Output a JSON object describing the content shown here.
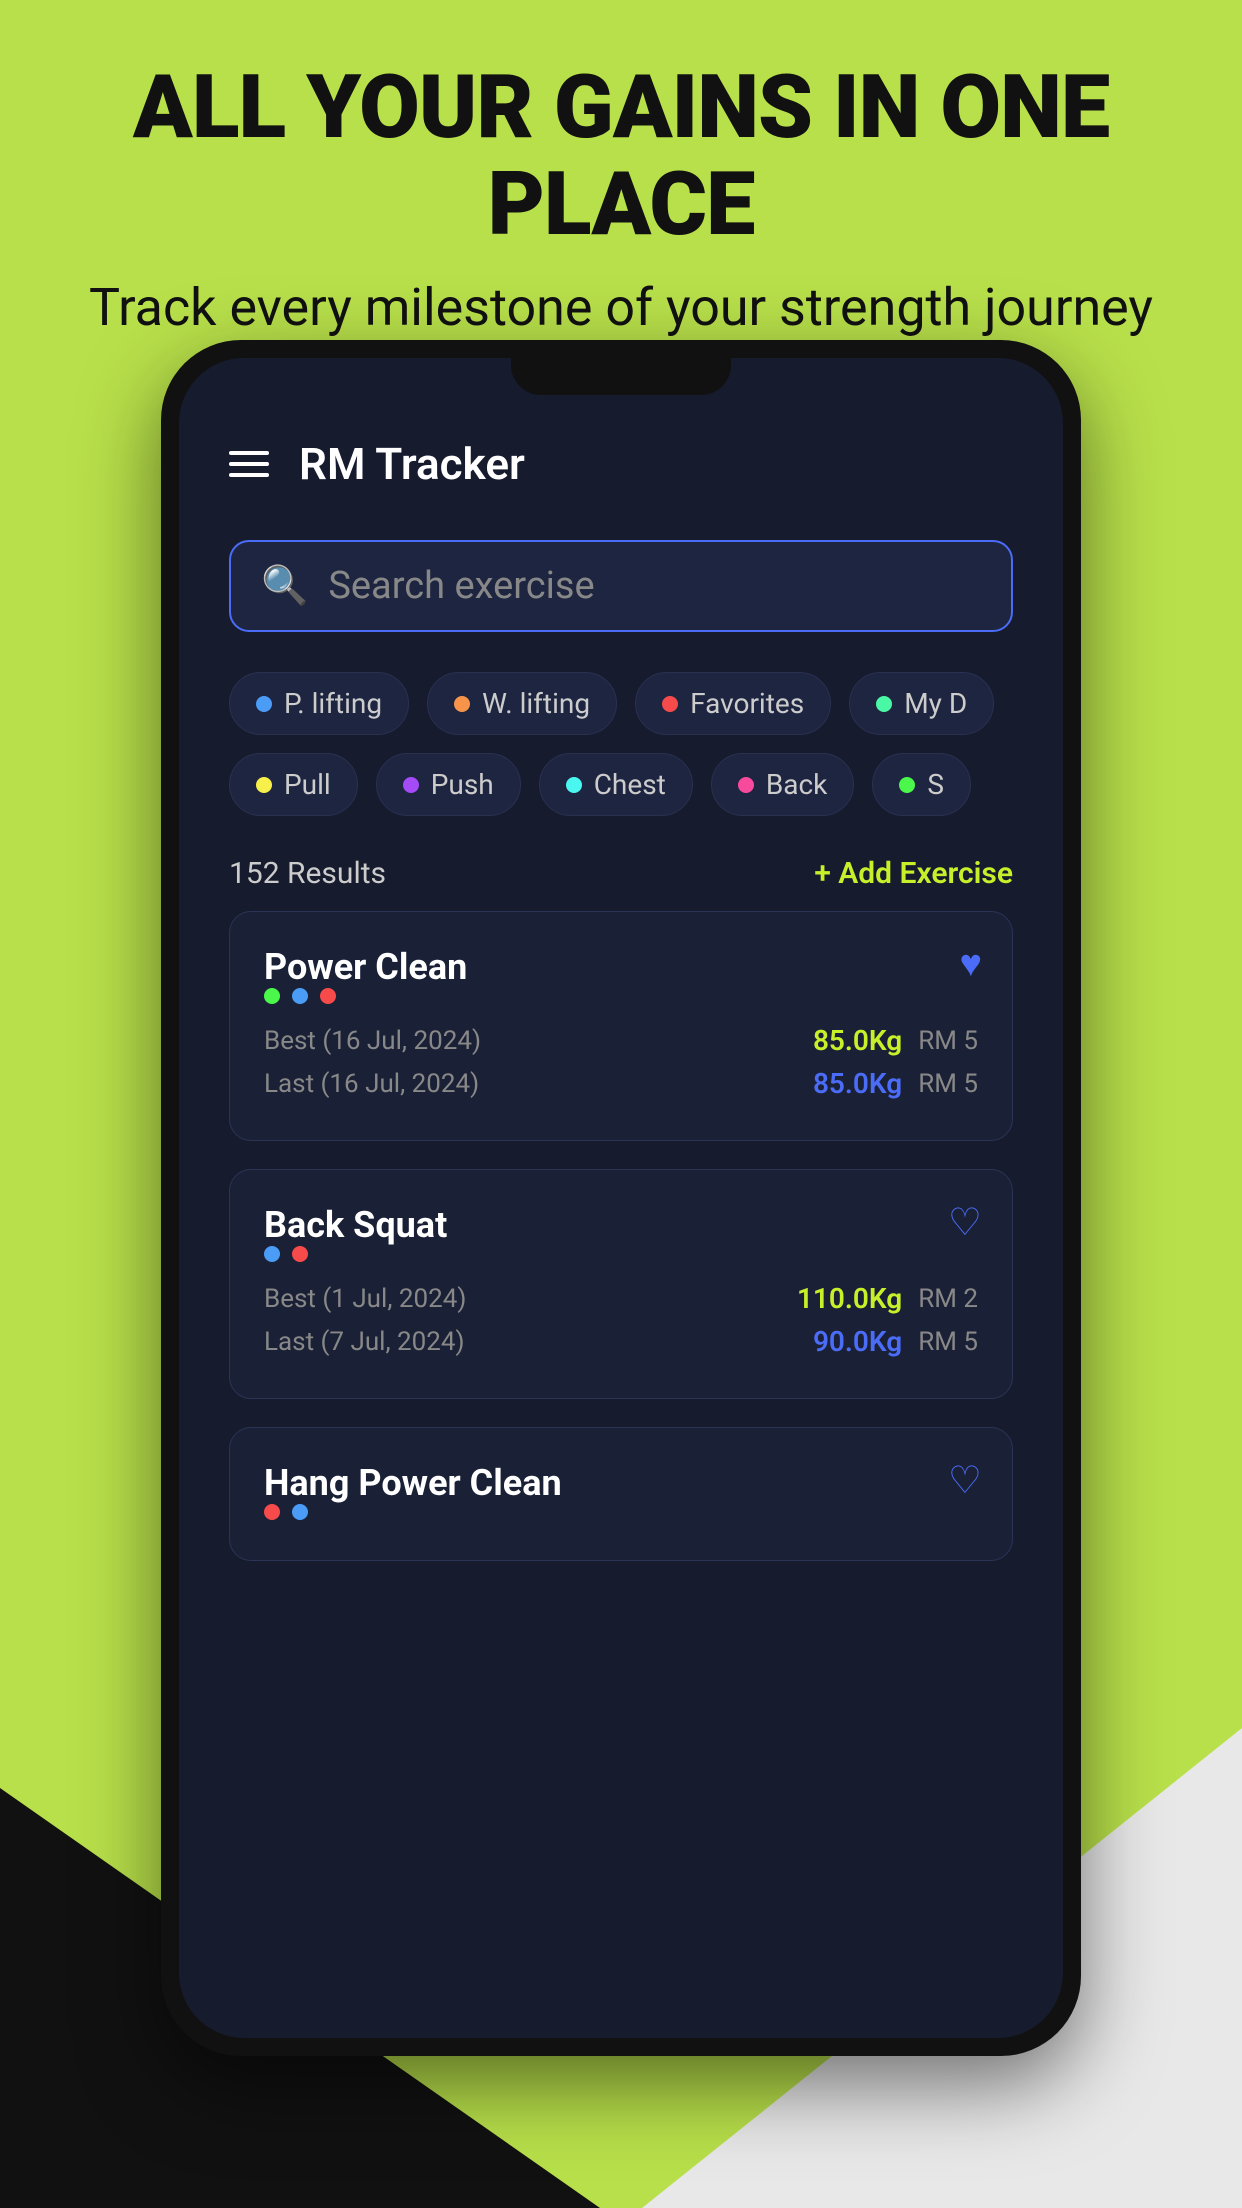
{
  "background": {
    "color": "#b8e04a"
  },
  "header": {
    "main_title": "ALL YOUR GAINS IN ONE PLACE",
    "subtitle": "Track every milestone of your strength journey"
  },
  "app": {
    "title": "RM Tracker"
  },
  "search": {
    "placeholder": "Search exercise"
  },
  "filter_row1": [
    {
      "id": "powerlifting",
      "label": "P. lifting",
      "dot_color": "#4a9cf7"
    },
    {
      "id": "weightlifting",
      "label": "W. lifting",
      "dot_color": "#f7944a"
    },
    {
      "id": "favorites",
      "label": "Favorites",
      "dot_color": "#f74a4a"
    },
    {
      "id": "my",
      "label": "My D",
      "dot_color": "#4af7a4"
    }
  ],
  "filter_row2": [
    {
      "id": "pull",
      "label": "Pull",
      "dot_color": "#f7f04a"
    },
    {
      "id": "push",
      "label": "Push",
      "dot_color": "#a44af7"
    },
    {
      "id": "chest",
      "label": "Chest",
      "dot_color": "#4af7f0"
    },
    {
      "id": "back",
      "label": "Back",
      "dot_color": "#f74a9c"
    },
    {
      "id": "more",
      "label": "S",
      "dot_color": "#4af74a"
    }
  ],
  "results": {
    "count": "152 Results",
    "add_label": "+ Add Exercise"
  },
  "exercises": [
    {
      "id": "power-clean",
      "name": "Power Clean",
      "dots": [
        "#4af74a",
        "#4a9cf7",
        "#f74a4a"
      ],
      "favorited": true,
      "best_date": "Best (16 Jul, 2024)",
      "best_value": "85.0Kg",
      "best_rm": "RM 5",
      "last_date": "Last (16 Jul, 2024)",
      "last_value": "85.0Kg",
      "last_rm": "RM 5"
    },
    {
      "id": "back-squat",
      "name": "Back Squat",
      "dots": [
        "#4a9cf7",
        "#f74a4a"
      ],
      "favorited": false,
      "best_date": "Best (1 Jul, 2024)",
      "best_value": "110.0Kg",
      "best_rm": "RM 2",
      "last_date": "Last (7 Jul, 2024)",
      "last_value": "90.0Kg",
      "last_rm": "RM 5"
    },
    {
      "id": "hang-power-clean",
      "name": "Hang Power Clean",
      "dots": [
        "#f74a4a",
        "#4a9cf7"
      ],
      "favorited": false,
      "best_date": "",
      "best_value": "",
      "best_rm": "",
      "last_date": "",
      "last_value": "",
      "last_rm": ""
    }
  ]
}
